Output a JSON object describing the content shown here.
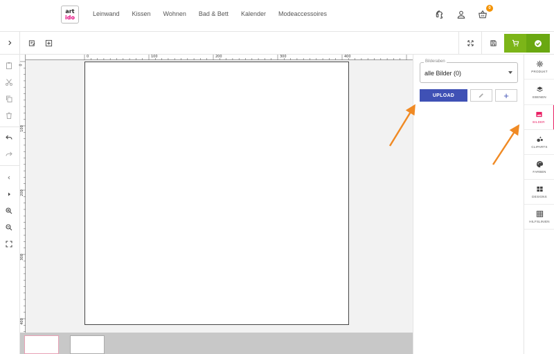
{
  "header": {
    "logo": {
      "line1": "art",
      "line2": "ido"
    },
    "nav": [
      "Leinwand",
      "Kissen",
      "Wohnen",
      "Bad & Bett",
      "Kalender",
      "Modeaccessoires"
    ],
    "cart_count": "0",
    "icons": [
      "support-headset-icon",
      "user-icon",
      "basket-icon"
    ]
  },
  "toolbar": {
    "left_icons": [
      "chevron-right-icon",
      "edit-note-icon",
      "add-box-icon"
    ],
    "right_icons": [
      "fullscreen-icon",
      "save-icon",
      "cart-icon",
      "check-circle-icon"
    ],
    "accent": "#7cb518"
  },
  "left_tools": [
    "paste-icon",
    "cut-icon",
    "copy-icon",
    "delete-icon",
    "undo-icon",
    "redo-icon",
    "chevron-left-icon",
    "play-icon",
    "zoom-in-icon",
    "zoom-out-icon",
    "fit-screen-icon"
  ],
  "ruler": {
    "top_labels": [
      "0",
      "100",
      "200",
      "300",
      "400"
    ],
    "left_labels": [
      "0",
      "100",
      "200",
      "300",
      "400"
    ]
  },
  "panel": {
    "layer_legend": "Bilderaben",
    "layer_value": "alle Bilder (0)",
    "upload_label": "UPLOAD",
    "add_label": "+",
    "primary_color": "#3f51b5"
  },
  "right_tabs": [
    {
      "label": "PRODUKT",
      "icon": "gear-icon"
    },
    {
      "label": "EBENEN",
      "icon": "layers-icon"
    },
    {
      "label": "BILDER",
      "icon": "image-icon",
      "active": true
    },
    {
      "label": "CLIPARTS",
      "icon": "cliparts-icon"
    },
    {
      "label": "FARBEN",
      "icon": "palette-icon"
    },
    {
      "label": "DESIGNS",
      "icon": "designs-icon"
    },
    {
      "label": "HILFSLINIEN",
      "icon": "grid-icon"
    }
  ],
  "active_color": "#e91e63"
}
